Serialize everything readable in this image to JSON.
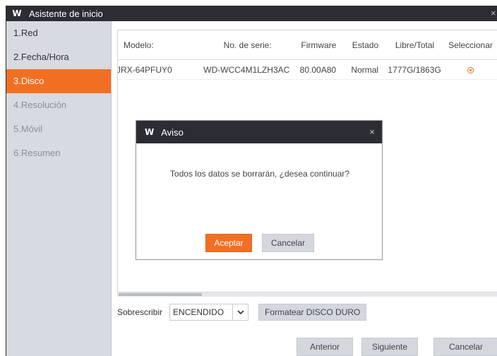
{
  "window": {
    "title": "Asistente de inicio",
    "logo": "W",
    "close": "×"
  },
  "sidebar": {
    "items": [
      {
        "label": "1.Red",
        "state": "normal"
      },
      {
        "label": "2.Fecha/Hora",
        "state": "normal"
      },
      {
        "label": "3.Disco",
        "state": "active"
      },
      {
        "label": "4.Resolución",
        "state": "disabled"
      },
      {
        "label": "5.Móvil",
        "state": "disabled"
      },
      {
        "label": "6.Resumen",
        "state": "disabled"
      }
    ]
  },
  "table": {
    "headers": {
      "model": "Modelo:",
      "serial": "No. de serie:",
      "firmware": "Firmware",
      "state": "Estado",
      "free_total": "Libre/Total",
      "select": "Seleccionar"
    },
    "rows": [
      {
        "model": "JRX-64PFUY0",
        "serial": "WD-WCC4M1LZH3AC",
        "firmware": "80.00A80",
        "state": "Normal",
        "free_total": "1777G/1863G",
        "selected": true
      }
    ]
  },
  "controls": {
    "overwrite_label": "Sobrescribir",
    "overwrite_value": "ENCENDIDO",
    "format_button": "Formatear DISCO DURO"
  },
  "nav": {
    "prev": "Anterior",
    "next": "Siguiente",
    "cancel": "Cancelar"
  },
  "dialog": {
    "logo": "W",
    "title": "Aviso",
    "close": "×",
    "message": "Todos los datos se borrarán, ¿desea continuar?",
    "ok": "Aceptar",
    "cancel": "Cancelar"
  },
  "colors": {
    "accent": "#f16f22",
    "titlebar": "#2b2d33",
    "sidebar": "#d7dae1"
  }
}
